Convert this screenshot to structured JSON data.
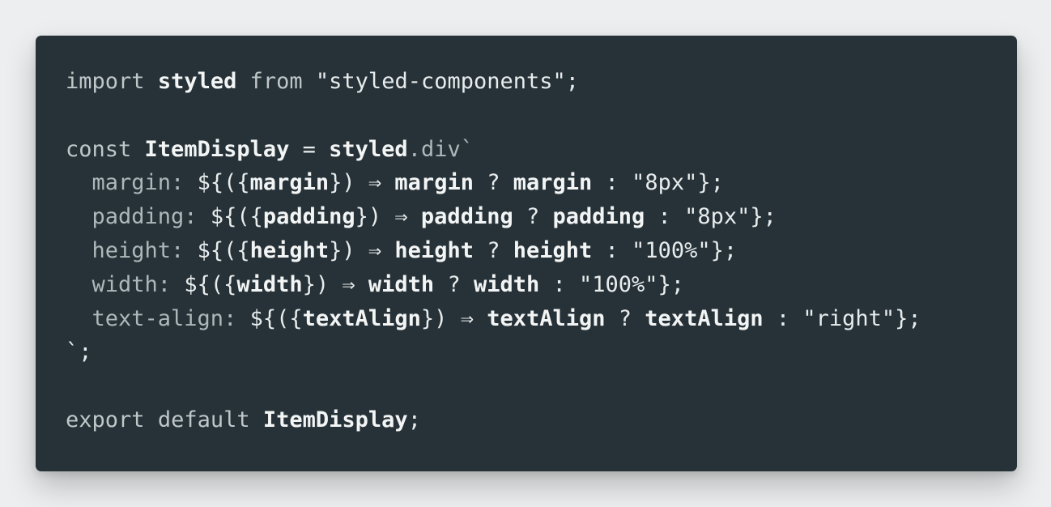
{
  "colors": {
    "page_background": "#eceeef",
    "editor_background": "#263238",
    "text": "#e8eced",
    "keyword": "#bfc7c9"
  },
  "code": {
    "language": "javascript",
    "lines": [
      [
        {
          "t": "import",
          "c": "kw"
        },
        {
          "t": " ",
          "c": "pn"
        },
        {
          "t": "styled",
          "c": "id"
        },
        {
          "t": " ",
          "c": "pn"
        },
        {
          "t": "from",
          "c": "kw"
        },
        {
          "t": " \"styled-components\";",
          "c": "str"
        }
      ],
      [],
      [
        {
          "t": "const",
          "c": "kw"
        },
        {
          "t": " ",
          "c": "pn"
        },
        {
          "t": "ItemDisplay",
          "c": "id"
        },
        {
          "t": " = ",
          "c": "pn"
        },
        {
          "t": "styled",
          "c": "id"
        },
        {
          "t": ".div`",
          "c": "dim"
        }
      ],
      [
        {
          "t": "  margin: ",
          "c": "dim"
        },
        {
          "t": "${({",
          "c": "pn"
        },
        {
          "t": "margin",
          "c": "id"
        },
        {
          "t": "}) ⇒ ",
          "c": "pn"
        },
        {
          "t": "margin",
          "c": "id"
        },
        {
          "t": " ? ",
          "c": "pn"
        },
        {
          "t": "margin",
          "c": "id"
        },
        {
          "t": " : \"8px\"};",
          "c": "str"
        }
      ],
      [
        {
          "t": "  padding: ",
          "c": "dim"
        },
        {
          "t": "${({",
          "c": "pn"
        },
        {
          "t": "padding",
          "c": "id"
        },
        {
          "t": "}) ⇒ ",
          "c": "pn"
        },
        {
          "t": "padding",
          "c": "id"
        },
        {
          "t": " ? ",
          "c": "pn"
        },
        {
          "t": "padding",
          "c": "id"
        },
        {
          "t": " : \"8px\"};",
          "c": "str"
        }
      ],
      [
        {
          "t": "  height: ",
          "c": "dim"
        },
        {
          "t": "${({",
          "c": "pn"
        },
        {
          "t": "height",
          "c": "id"
        },
        {
          "t": "}) ⇒ ",
          "c": "pn"
        },
        {
          "t": "height",
          "c": "id"
        },
        {
          "t": " ? ",
          "c": "pn"
        },
        {
          "t": "height",
          "c": "id"
        },
        {
          "t": " : \"100%\"};",
          "c": "str"
        }
      ],
      [
        {
          "t": "  width: ",
          "c": "dim"
        },
        {
          "t": "${({",
          "c": "pn"
        },
        {
          "t": "width",
          "c": "id"
        },
        {
          "t": "}) ⇒ ",
          "c": "pn"
        },
        {
          "t": "width",
          "c": "id"
        },
        {
          "t": " ? ",
          "c": "pn"
        },
        {
          "t": "width",
          "c": "id"
        },
        {
          "t": " : \"100%\"};",
          "c": "str"
        }
      ],
      [
        {
          "t": "  text-align: ",
          "c": "dim"
        },
        {
          "t": "${({",
          "c": "pn"
        },
        {
          "t": "textAlign",
          "c": "id"
        },
        {
          "t": "}) ⇒ ",
          "c": "pn"
        },
        {
          "t": "textAlign",
          "c": "id"
        },
        {
          "t": " ? ",
          "c": "pn"
        },
        {
          "t": "textAlign",
          "c": "id"
        },
        {
          "t": " : \"right\"};",
          "c": "str"
        }
      ],
      [
        {
          "t": "`;",
          "c": "pn"
        }
      ],
      [],
      [
        {
          "t": "export",
          "c": "kw"
        },
        {
          "t": " ",
          "c": "pn"
        },
        {
          "t": "default",
          "c": "kw"
        },
        {
          "t": " ",
          "c": "pn"
        },
        {
          "t": "ItemDisplay",
          "c": "id"
        },
        {
          "t": ";",
          "c": "pn"
        }
      ]
    ]
  }
}
